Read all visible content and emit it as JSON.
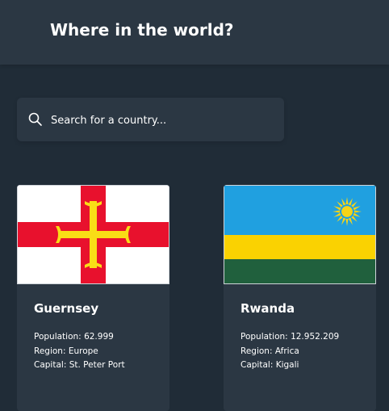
{
  "header": {
    "title": "Where in the world?"
  },
  "search": {
    "placeholder": "Search for a country...",
    "icon": "search-icon"
  },
  "countries": [
    {
      "name": "Guernsey",
      "population_label": "Population:",
      "population": "62.999",
      "region_label": "Region:",
      "region": "Europe",
      "capital_label": "Capital:",
      "capital": "St. Peter Port",
      "flag_icon": "guernsey-flag"
    },
    {
      "name": "Rwanda",
      "population_label": "Population:",
      "population": "12.952.209",
      "region_label": "Region:",
      "region": "Africa",
      "capital_label": "Capital:",
      "capital": "Kigali",
      "flag_icon": "rwanda-flag"
    }
  ],
  "colors": {
    "background": "#202c37",
    "element": "#2b3743",
    "text": "#ffffff"
  }
}
